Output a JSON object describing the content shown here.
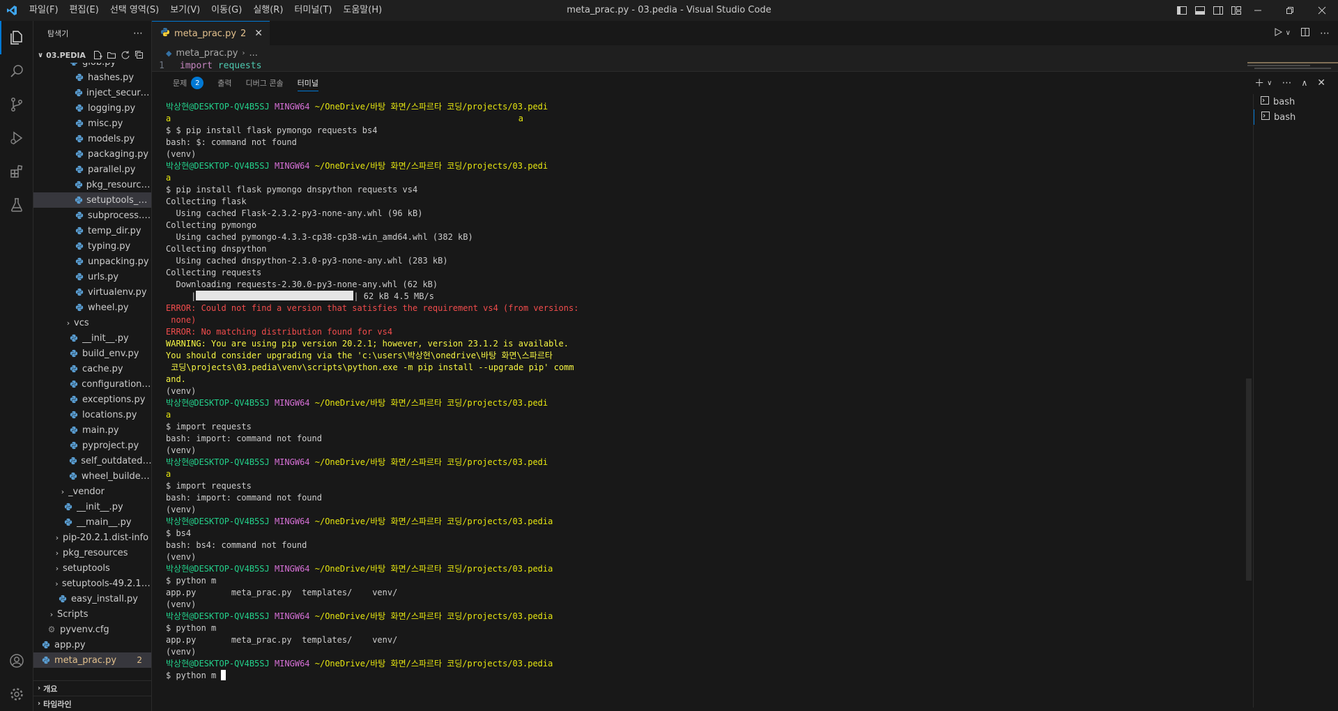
{
  "titlebar": {
    "menu": [
      "파일(F)",
      "편집(E)",
      "선택 영역(S)",
      "보기(V)",
      "이동(G)",
      "실행(R)",
      "터미널(T)",
      "도움말(H)"
    ],
    "title": "meta_prac.py - 03.pedia - Visual Studio Code"
  },
  "sidebar": {
    "header": "탐색기",
    "root": "03.PEDIA",
    "items": [
      {
        "label": "glob.py",
        "kind": "file",
        "indent": 50
      },
      {
        "label": "hashes.py",
        "kind": "file",
        "indent": 58
      },
      {
        "label": "inject_securetr...",
        "kind": "file",
        "indent": 58
      },
      {
        "label": "logging.py",
        "kind": "file",
        "indent": 58
      },
      {
        "label": "misc.py",
        "kind": "file",
        "indent": 58
      },
      {
        "label": "models.py",
        "kind": "file",
        "indent": 58
      },
      {
        "label": "packaging.py",
        "kind": "file",
        "indent": 58
      },
      {
        "label": "parallel.py",
        "kind": "file",
        "indent": 58
      },
      {
        "label": "pkg_resources....",
        "kind": "file",
        "indent": 58
      },
      {
        "label": "setuptools_bui...",
        "kind": "file",
        "indent": 58,
        "selected": true
      },
      {
        "label": "subprocess.py",
        "kind": "file",
        "indent": 58
      },
      {
        "label": "temp_dir.py",
        "kind": "file",
        "indent": 58
      },
      {
        "label": "typing.py",
        "kind": "file",
        "indent": 58
      },
      {
        "label": "unpacking.py",
        "kind": "file",
        "indent": 58
      },
      {
        "label": "urls.py",
        "kind": "file",
        "indent": 58
      },
      {
        "label": "virtualenv.py",
        "kind": "file",
        "indent": 58
      },
      {
        "label": "wheel.py",
        "kind": "file",
        "indent": 58
      },
      {
        "label": "vcs",
        "kind": "folder",
        "indent": 42
      },
      {
        "label": "__init__.py",
        "kind": "file",
        "indent": 50
      },
      {
        "label": "build_env.py",
        "kind": "file",
        "indent": 50
      },
      {
        "label": "cache.py",
        "kind": "file",
        "indent": 50
      },
      {
        "label": "configuration.py",
        "kind": "file",
        "indent": 50
      },
      {
        "label": "exceptions.py",
        "kind": "file",
        "indent": 50
      },
      {
        "label": "locations.py",
        "kind": "file",
        "indent": 50
      },
      {
        "label": "main.py",
        "kind": "file",
        "indent": 50
      },
      {
        "label": "pyproject.py",
        "kind": "file",
        "indent": 50
      },
      {
        "label": "self_outdated_c...",
        "kind": "file",
        "indent": 50
      },
      {
        "label": "wheel_builder.py",
        "kind": "file",
        "indent": 50
      },
      {
        "label": "_vendor",
        "kind": "folder",
        "indent": 34
      },
      {
        "label": "__init__.py",
        "kind": "file",
        "indent": 42
      },
      {
        "label": "__main__.py",
        "kind": "file",
        "indent": 42
      },
      {
        "label": "pip-20.2.1.dist-info",
        "kind": "folder",
        "indent": 26
      },
      {
        "label": "pkg_resources",
        "kind": "folder",
        "indent": 26
      },
      {
        "label": "setuptools",
        "kind": "folder",
        "indent": 26
      },
      {
        "label": "setuptools-49.2.1.d...",
        "kind": "folder",
        "indent": 26
      },
      {
        "label": "easy_install.py",
        "kind": "file",
        "indent": 34
      },
      {
        "label": "Scripts",
        "kind": "folder",
        "indent": 18
      },
      {
        "label": "pyvenv.cfg",
        "kind": "config",
        "indent": 18
      },
      {
        "label": "app.py",
        "kind": "file",
        "indent": 10
      },
      {
        "label": "meta_prac.py",
        "kind": "file",
        "indent": 10,
        "active": true,
        "badge": "2"
      }
    ],
    "footer": [
      "개요",
      "타임라인"
    ]
  },
  "editor": {
    "tab_label": "meta_prac.py",
    "tab_badge": "2",
    "breadcrumb_file": "meta_prac.py",
    "breadcrumb_more": "...",
    "line_number": "1",
    "code_keyword": "import",
    "code_module": "requests"
  },
  "panel": {
    "tabs": [
      {
        "label": "문제",
        "count": "2"
      },
      {
        "label": "출력"
      },
      {
        "label": "디버그 콘솔"
      },
      {
        "label": "터미널",
        "active": true
      }
    ],
    "terminals": [
      "bash",
      "bash"
    ]
  },
  "terminal": {
    "lines": [
      [
        [
          "user",
          "박상현@DESKTOP-QV4B5SJ "
        ],
        [
          "ming",
          "MINGW64 "
        ],
        [
          "path",
          "~/OneDrive/바탕 화면/스파르타 코딩/projects/03.pedi"
        ]
      ],
      [
        [
          "path",
          "a                                                                     a"
        ]
      ],
      [
        [
          "plain",
          "$ $ pip install flask pymongo requests bs4"
        ]
      ],
      [
        [
          "plain",
          "bash: $: command not found"
        ]
      ],
      [
        [
          "plain",
          "(venv)"
        ]
      ],
      [
        [
          "user",
          "박상현@DESKTOP-QV4B5SJ "
        ],
        [
          "ming",
          "MINGW64 "
        ],
        [
          "path",
          "~/OneDrive/바탕 화면/스파르타 코딩/projects/03.pedi"
        ]
      ],
      [
        [
          "path",
          "a"
        ]
      ],
      [
        [
          "plain",
          "$ pip install flask pymongo dnspython requests vs4"
        ]
      ],
      [
        [
          "plain",
          "Collecting flask"
        ]
      ],
      [
        [
          "plain",
          "  Using cached Flask-2.3.2-py3-none-any.whl (96 kB)"
        ]
      ],
      [
        [
          "plain",
          "Collecting pymongo"
        ]
      ],
      [
        [
          "plain",
          "  Using cached pymongo-4.3.3-cp38-cp38-win_amd64.whl (382 kB)"
        ]
      ],
      [
        [
          "plain",
          "Collecting dnspython"
        ]
      ],
      [
        [
          "plain",
          "  Using cached dnspython-2.3.0-py3-none-any.whl (283 kB)"
        ]
      ],
      [
        [
          "plain",
          "Collecting requests"
        ]
      ],
      [
        [
          "plain",
          "  Downloading requests-2.30.0-py3-none-any.whl (62 kB)"
        ]
      ],
      [
        [
          "plain",
          "     |"
        ],
        [
          "bar",
          ""
        ],
        [
          "plain",
          "| 62 kB 4.5 MB/s"
        ]
      ],
      [
        [
          "red",
          "ERROR: Could not find a version that satisfies the requirement vs4 (from versions:"
        ]
      ],
      [
        [
          "red",
          " none)"
        ]
      ],
      [
        [
          "red",
          "ERROR: No matching distribution found for vs4"
        ]
      ],
      [
        [
          "yellow",
          "WARNING: You are using pip version 20.2.1; however, version 23.1.2 is available."
        ]
      ],
      [
        [
          "yellow",
          "You should consider upgrading via the 'c:\\users\\박상현\\onedrive\\바탕 화면\\스파르타"
        ]
      ],
      [
        [
          "yellow",
          " 코딩\\projects\\03.pedia\\venv\\scripts\\python.exe -m pip install --upgrade pip' comm"
        ]
      ],
      [
        [
          "yellow",
          "and."
        ]
      ],
      [
        [
          "plain",
          "(venv)"
        ]
      ],
      [
        [
          "user",
          "박상현@DESKTOP-QV4B5SJ "
        ],
        [
          "ming",
          "MINGW64 "
        ],
        [
          "path",
          "~/OneDrive/바탕 화면/스파르타 코딩/projects/03.pedi"
        ]
      ],
      [
        [
          "path",
          "a"
        ]
      ],
      [
        [
          "plain",
          "$ import requests"
        ]
      ],
      [
        [
          "plain",
          "bash: import: command not found"
        ]
      ],
      [
        [
          "plain",
          "(venv)"
        ]
      ],
      [
        [
          "user",
          "박상현@DESKTOP-QV4B5SJ "
        ],
        [
          "ming",
          "MINGW64 "
        ],
        [
          "path",
          "~/OneDrive/바탕 화면/스파르타 코딩/projects/03.pedi"
        ]
      ],
      [
        [
          "path",
          "a"
        ]
      ],
      [
        [
          "plain",
          "$ import requests"
        ]
      ],
      [
        [
          "plain",
          "bash: import: command not found"
        ]
      ],
      [
        [
          "plain",
          "(venv)"
        ]
      ],
      [
        [
          "user",
          "박상현@DESKTOP-QV4B5SJ "
        ],
        [
          "ming",
          "MINGW64 "
        ],
        [
          "path",
          "~/OneDrive/바탕 화면/스파르타 코딩/projects/03.pedia"
        ]
      ],
      [
        [
          "plain",
          "$ bs4"
        ]
      ],
      [
        [
          "plain",
          "bash: bs4: command not found"
        ]
      ],
      [
        [
          "plain",
          "(venv)"
        ]
      ],
      [
        [
          "user",
          "박상현@DESKTOP-QV4B5SJ "
        ],
        [
          "ming",
          "MINGW64 "
        ],
        [
          "path",
          "~/OneDrive/바탕 화면/스파르타 코딩/projects/03.pedia"
        ]
      ],
      [
        [
          "plain",
          "$ python m"
        ]
      ],
      [
        [
          "plain",
          "app.py       meta_prac.py  templates/    venv/"
        ]
      ],
      [
        [
          "plain",
          "(venv)"
        ]
      ],
      [
        [
          "user",
          "박상현@DESKTOP-QV4B5SJ "
        ],
        [
          "ming",
          "MINGW64 "
        ],
        [
          "path",
          "~/OneDrive/바탕 화면/스파르타 코딩/projects/03.pedia"
        ]
      ],
      [
        [
          "plain",
          "$ python m"
        ]
      ],
      [
        [
          "plain",
          "app.py       meta_prac.py  templates/    venv/"
        ]
      ],
      [
        [
          "plain",
          "(venv)"
        ]
      ],
      [
        [
          "user",
          "박상현@DESKTOP-QV4B5SJ "
        ],
        [
          "ming",
          "MINGW64 "
        ],
        [
          "path",
          "~/OneDrive/바탕 화면/스파르타 코딩/projects/03.pedia"
        ]
      ],
      [
        [
          "plain",
          "$ python m "
        ],
        [
          "cursor",
          ""
        ]
      ]
    ]
  },
  "colors": {
    "accent": "#0078d4",
    "modified": "#e2c08d",
    "term_green": "#23d18b",
    "term_magenta": "#d670d6",
    "term_yellow": "#e5e510",
    "term_red": "#f14c4c"
  }
}
